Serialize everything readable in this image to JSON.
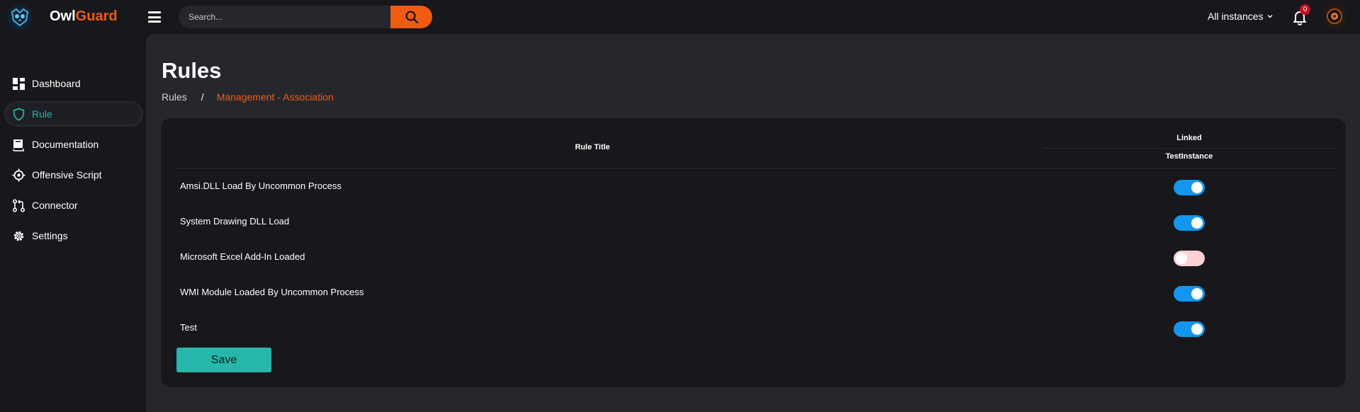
{
  "app": {
    "brand_part1": "Owl",
    "brand_part2": "Guard",
    "accent_color": "#f05a12",
    "active_color": "#27b6aa"
  },
  "topbar": {
    "search_placeholder": "Search...",
    "instances_label": "All instances",
    "notification_count": "0"
  },
  "sidebar": {
    "items": [
      {
        "label": "Dashboard",
        "icon": "dashboard-icon",
        "active": false
      },
      {
        "label": "Rule",
        "icon": "shield-icon",
        "active": true
      },
      {
        "label": "Documentation",
        "icon": "book-icon",
        "active": false
      },
      {
        "label": "Offensive Script",
        "icon": "crosshair-icon",
        "active": false
      },
      {
        "label": "Connector",
        "icon": "git-pull-request-icon",
        "active": false
      },
      {
        "label": "Settings",
        "icon": "gear-icon",
        "active": false
      }
    ]
  },
  "page": {
    "title": "Rules",
    "breadcrumb": {
      "root": "Rules",
      "separator": "/",
      "current": "Management - Association"
    }
  },
  "table": {
    "col_title": "Rule Title",
    "col_linked": "Linked",
    "col_instance": "TestInstance",
    "rows": [
      {
        "title": "Amsi.DLL Load By Uncommon Process",
        "linked": true
      },
      {
        "title": "System Drawing DLL Load",
        "linked": true
      },
      {
        "title": "Microsoft Excel Add-In Loaded",
        "linked": false
      },
      {
        "title": "WMI Module Loaded By Uncommon Process",
        "linked": true
      },
      {
        "title": "Test",
        "linked": true
      }
    ]
  },
  "actions": {
    "save_label": "Save"
  }
}
